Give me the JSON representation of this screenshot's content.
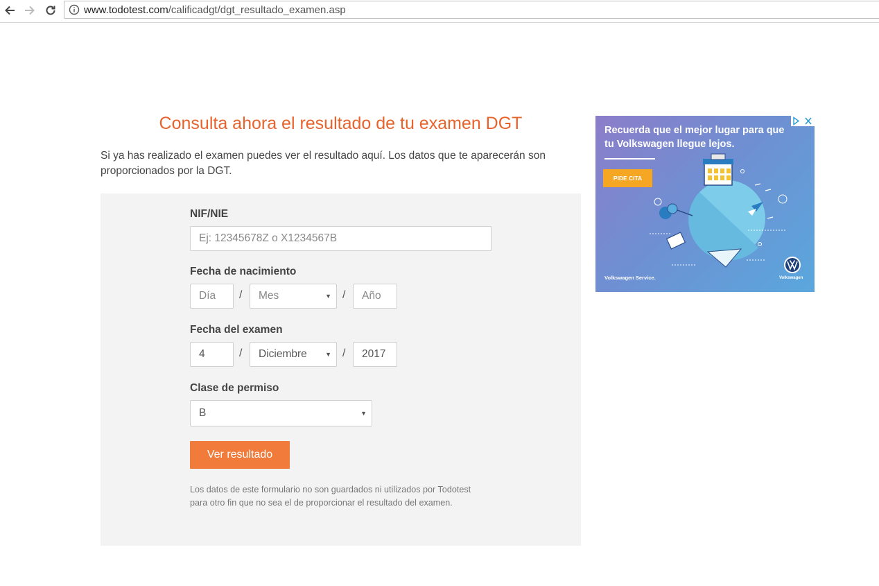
{
  "browser": {
    "url_host": "www.todotest.com",
    "url_path": "/calificadgt/dgt_resultado_examen.asp"
  },
  "page": {
    "title": "Consulta ahora el resultado de tu examen DGT",
    "intro": "Si ya has realizado el examen puedes ver el resultado aquí. Los datos que te aparecerán son proporcionados por la DGT."
  },
  "form": {
    "nif_label": "NIF/NIE",
    "nif_placeholder": "Ej: 12345678Z o X1234567B",
    "birth_label": "Fecha de nacimiento",
    "birth_day_placeholder": "Día",
    "birth_month_value": "Mes",
    "birth_year_placeholder": "Año",
    "exam_label": "Fecha del examen",
    "exam_day_value": "4",
    "exam_month_value": "Diciembre",
    "exam_year_value": "2017",
    "license_label": "Clase de permiso",
    "license_value": "B",
    "separator": "/",
    "submit_label": "Ver resultado",
    "note": "Los datos de este formulario no son guardados ni utilizados por Todotest para otro fin que no sea el de proporcionar el resultado del examen."
  },
  "ad": {
    "headline": "Recuerda que el mejor lugar para que tu Volkswagen llegue lejos.",
    "cta": "PIDE CITA",
    "service": "Volkswagen Service.",
    "brand": "Volkswagen"
  },
  "colors": {
    "accent": "#e8632c",
    "button": "#f07b3a",
    "panel": "#f3f3f3",
    "ad_cta": "#f5a623"
  }
}
